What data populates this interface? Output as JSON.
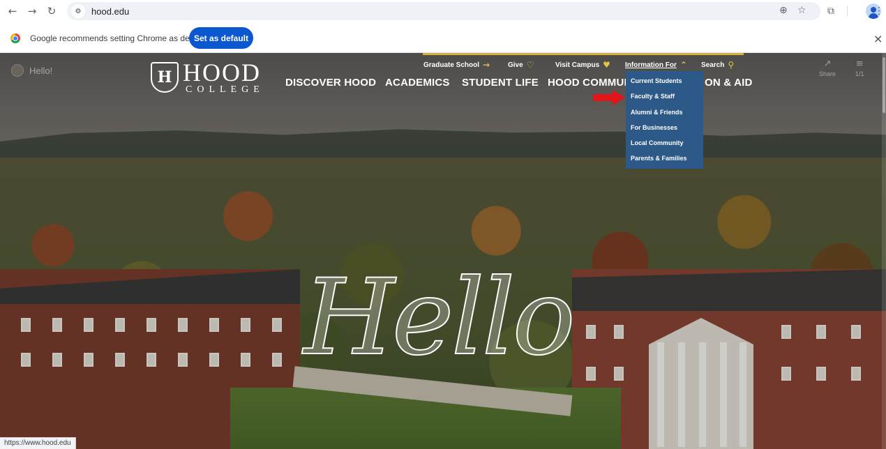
{
  "browser": {
    "back": "←",
    "forward": "→",
    "reload": "↻",
    "url": "hood.edu",
    "zoom_icon": "zoom-icon",
    "bookmark_icon": "star-icon",
    "extensions_icon": "puzzle-icon",
    "menu_icon": "kebab-menu-icon"
  },
  "infobar": {
    "message": "Google recommends setting Chrome as default",
    "button": "Set as default",
    "close": "×"
  },
  "site": {
    "hello_pill": "Hello!",
    "logo": {
      "mark": "H",
      "name": "HOOD",
      "sub": "COLLEGE"
    },
    "utility_nav": [
      {
        "label": "Graduate School",
        "icon": "→"
      },
      {
        "label": "Give",
        "icon": "♡"
      },
      {
        "label": "Visit Campus",
        "icon": "♥"
      },
      {
        "label": "Information For",
        "icon": "⌃"
      },
      {
        "label": "Search",
        "icon": "⚲"
      }
    ],
    "main_nav": [
      {
        "label": "DISCOVER HOOD"
      },
      {
        "label": "ACADEMICS"
      },
      {
        "label": "STUDENT LIFE"
      },
      {
        "label": "HOOD COMMUNI"
      },
      {
        "label": "ON & AID"
      }
    ],
    "dropdown": [
      "Current Students",
      "Faculty & Staff",
      "Alumni & Friends",
      "For Businesses",
      "Local Community",
      "Parents & Families"
    ],
    "share": {
      "label": "Share",
      "icon": "↗"
    },
    "counter": {
      "label": "1/1",
      "icon": "≡"
    },
    "hero_text": "Hello"
  },
  "status_url": "https://www.hood.edu",
  "colors": {
    "accent": "#0b57d0",
    "gold": "#d8b23a",
    "dropdown": "#2d5989",
    "arrow": "#e3151a"
  }
}
